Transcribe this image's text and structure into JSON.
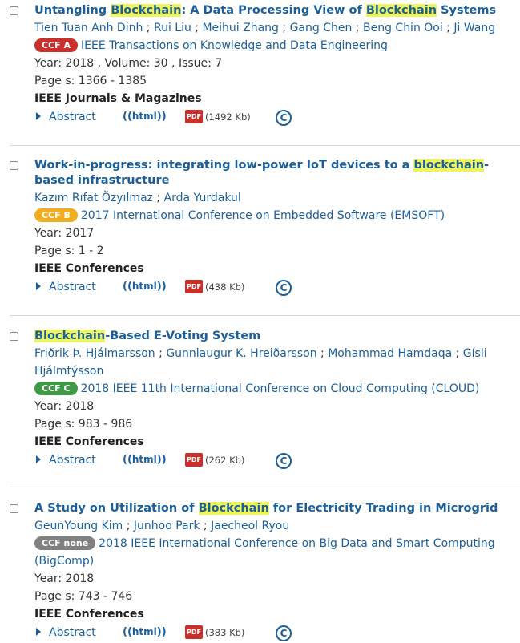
{
  "results": [
    {
      "title_parts": [
        {
          "t": "Untangling ",
          "hl": false
        },
        {
          "t": "Blockchain",
          "hl": true
        },
        {
          "t": ": A Data Processing View of ",
          "hl": false
        },
        {
          "t": "Blockchain",
          "hl": true
        },
        {
          "t": " Systems",
          "hl": false
        }
      ],
      "authors": [
        "Tien Tuan Anh Dinh",
        "Rui Liu",
        "Meihui Zhang",
        "Gang Chen",
        "Beng Chin Ooi",
        "Ji Wang"
      ],
      "ccf": "CCF A",
      "venue": "IEEE Transactions on Knowledge and Data Engineering",
      "year_text": "Year: 2018 , Volume: 30 , Issue: 7",
      "pages": "Page s: 1366 - 1385",
      "type": "IEEE Journals & Magazines",
      "pdf_size": "(1492 Kb)"
    },
    {
      "title_parts": [
        {
          "t": "Work-in-progress: integrating low-power IoT devices to a ",
          "hl": false
        },
        {
          "t": "blockchain",
          "hl": true
        },
        {
          "t": "-based infrastructure",
          "hl": false
        }
      ],
      "authors": [
        "Kazım Rıfat Özyılmaz",
        "Arda Yurdakul"
      ],
      "ccf": "CCF B",
      "venue": "2017 International Conference on Embedded Software (EMSOFT)",
      "year_text": "Year: 2017",
      "pages": "Page s: 1 - 2",
      "type": "IEEE Conferences",
      "pdf_size": "(438 Kb)"
    },
    {
      "title_parts": [
        {
          "t": "Blockchain",
          "hl": true
        },
        {
          "t": "-Based E-Voting System",
          "hl": false
        }
      ],
      "authors": [
        "Friðrik Þ. Hjálmarsson",
        "Gunnlaugur K. Hreiðarsson",
        "Mohammad Hamdaqa",
        "Gísli Hjálmtýsson"
      ],
      "ccf": "CCF C",
      "venue": "2018 IEEE 11th International Conference on Cloud Computing (CLOUD)",
      "year_text": "Year: 2018",
      "pages": "Page s: 983 - 986",
      "type": "IEEE Conferences",
      "pdf_size": "(262 Kb)"
    },
    {
      "title_parts": [
        {
          "t": "A Study on Utilization of ",
          "hl": false
        },
        {
          "t": "Blockchain",
          "hl": true
        },
        {
          "t": " for Electricity Trading in Microgrid",
          "hl": false
        }
      ],
      "authors": [
        "GeunYoung Kim",
        "Junhoo Park",
        "Jaecheol Ryou"
      ],
      "ccf": "CCF none",
      "venue": "2018 IEEE International Conference on Big Data and Smart Computing (BigComp)",
      "year_text": "Year: 2018",
      "pages": "Page s: 743 - 746",
      "type": "IEEE Conferences",
      "pdf_size": "(383 Kb)"
    }
  ],
  "labels": {
    "abstract": "Abstract",
    "html": "html",
    "pdf": "PDF",
    "author_sep": " ; ",
    "copyright": "C"
  },
  "colors": {
    "ccf_a": "#c9302c",
    "ccf_b": "#f0ad1f",
    "ccf_c": "#3f9a46",
    "ccf_none": "#808080",
    "link": "#1a5f9c",
    "highlight": "#f1f55d"
  }
}
